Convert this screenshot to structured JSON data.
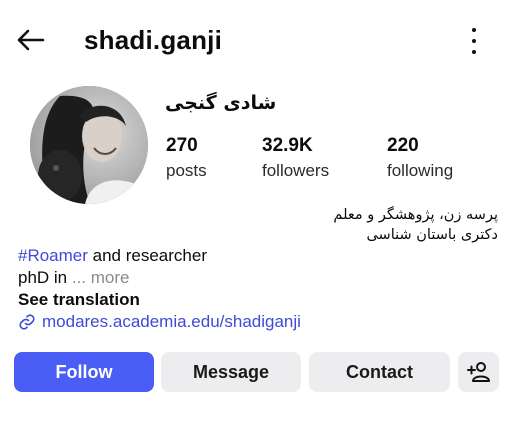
{
  "header": {
    "back_icon": "arrow-left-icon",
    "username": "shadi.ganji",
    "menu_icon": "more-vertical-icon"
  },
  "profile": {
    "display_name": "شادی گنجی",
    "avatar": "profile-photo"
  },
  "stats": [
    {
      "value": "270",
      "label": "posts"
    },
    {
      "value": "32.9K",
      "label": "followers"
    },
    {
      "value": "220",
      "label": "following"
    }
  ],
  "bio": {
    "line1": "پرسه زن، پژوهشگر و معلم",
    "line2": "دکتری باستان شناسی",
    "hashtag": "#Roamer",
    "line3_rest": " and researcher",
    "line4": "phD in",
    "more": " ... more",
    "translation": "See translation",
    "link_icon": "link-icon",
    "link": "modares.academia.edu/shadiganji"
  },
  "actions": {
    "follow": "Follow",
    "message": "Message",
    "contact": "Contact",
    "add_user_icon": "add-user-icon"
  },
  "colors": {
    "accent": "#4a5ef5",
    "link": "#3f4ad6",
    "button_bg": "#ededf0"
  }
}
